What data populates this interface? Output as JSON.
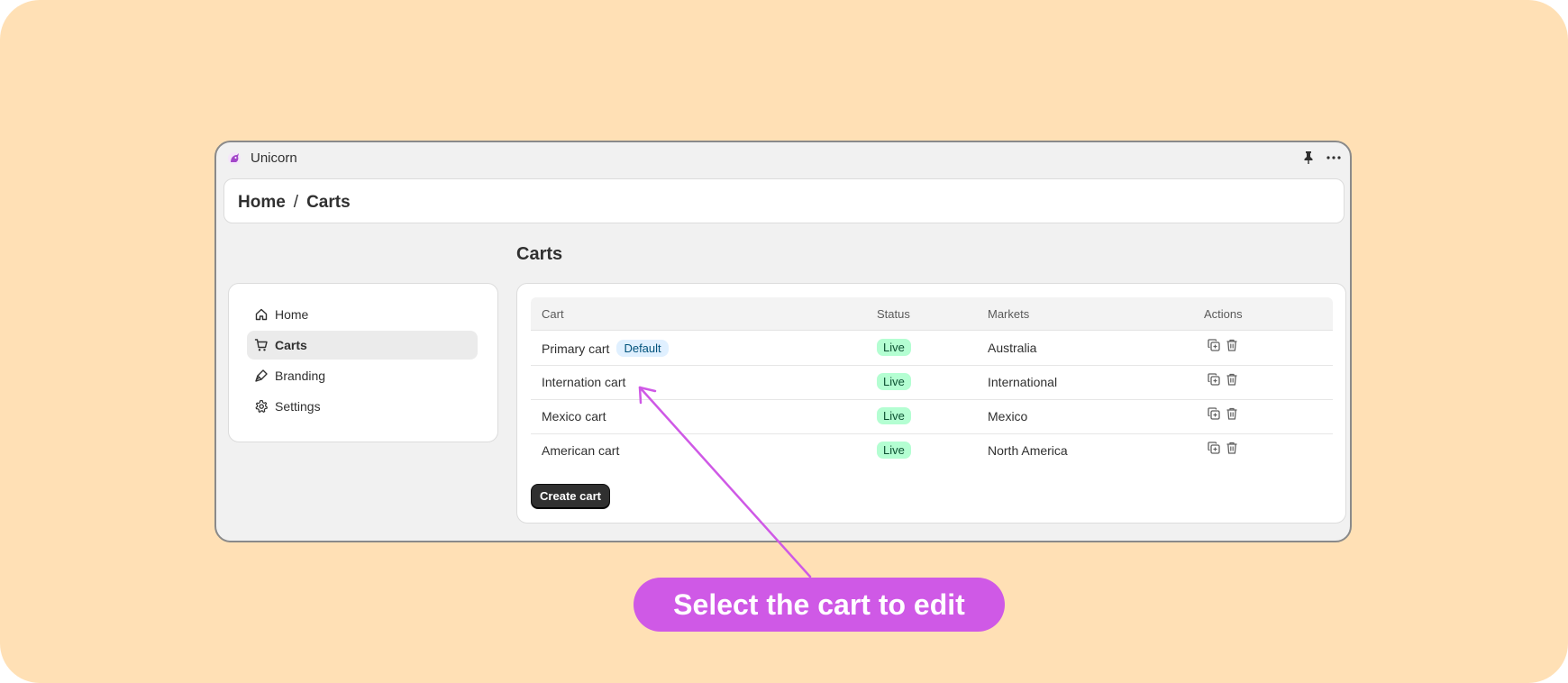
{
  "app": {
    "name": "Unicorn"
  },
  "breadcrumb": {
    "home": "Home",
    "separator": "/",
    "current": "Carts"
  },
  "sidebar": {
    "items": [
      {
        "label": "Home",
        "icon": "home-icon",
        "active": false
      },
      {
        "label": "Carts",
        "icon": "cart-icon",
        "active": true
      },
      {
        "label": "Branding",
        "icon": "brush-icon",
        "active": false
      },
      {
        "label": "Settings",
        "icon": "gear-icon",
        "active": false
      }
    ]
  },
  "page": {
    "title": "Carts"
  },
  "table": {
    "headers": {
      "cart": "Cart",
      "status": "Status",
      "markets": "Markets",
      "actions": "Actions"
    },
    "rows": [
      {
        "cart": "Primary cart",
        "badge": "Default",
        "status": "Live",
        "market": "Australia"
      },
      {
        "cart": "Internation cart",
        "status": "Live",
        "market": "International"
      },
      {
        "cart": "Mexico cart",
        "status": "Live",
        "market": "Mexico"
      },
      {
        "cart": "American cart",
        "status": "Live",
        "market": "North America"
      }
    ],
    "action_icons": [
      "duplicate-icon",
      "trash-icon"
    ]
  },
  "create_button": {
    "label": "Create cart"
  },
  "callout": {
    "text": "Select the cart to edit"
  },
  "colors": {
    "background": "#ffe0b5",
    "callout": "#cf59e6",
    "live_badge": "#b4fed2",
    "default_badge": "#e0f0ff",
    "primary_button": "#303030"
  }
}
